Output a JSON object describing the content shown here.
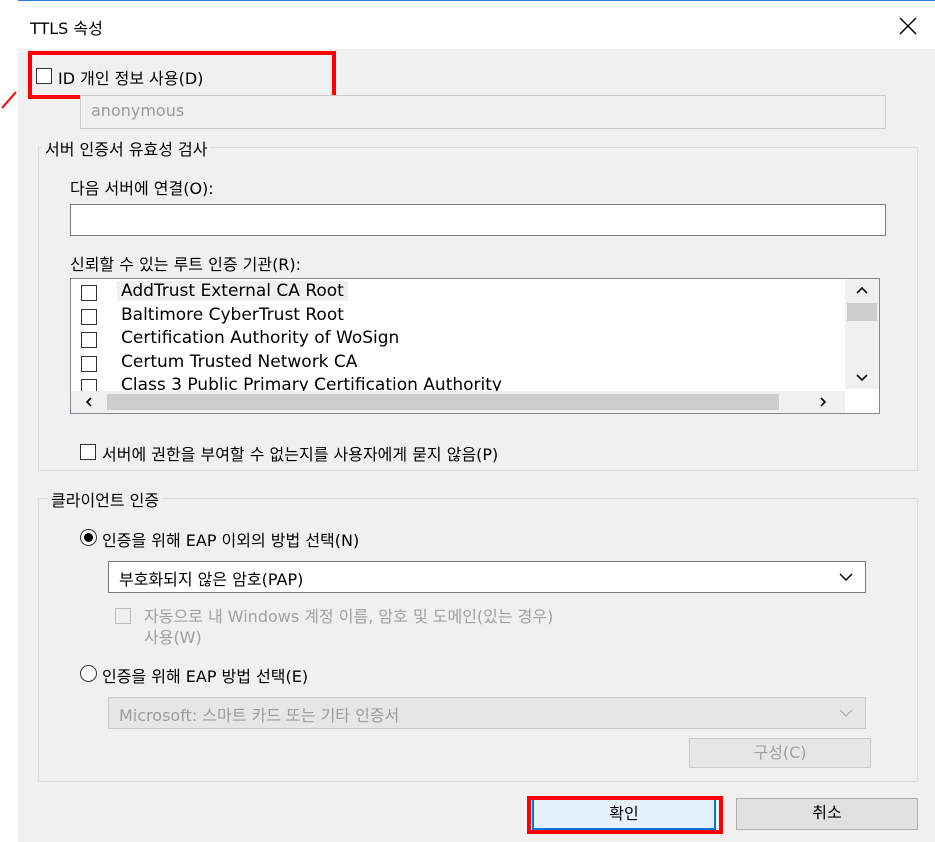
{
  "dialog": {
    "title": "TTLS 속성",
    "close_icon": "close-icon"
  },
  "identity": {
    "checkbox_label": "ID 개인 정보 사용(D)",
    "checked": false,
    "value": "anonymous"
  },
  "server_validation": {
    "group_label": "서버 인증서 유효성 검사",
    "connect_label": "다음 서버에 연결(O):",
    "connect_value": "",
    "trusted_ca_label": "신뢰할 수 있는 루트 인증 기관(R):",
    "ca_list": [
      {
        "name": "AddTrust External CA Root",
        "checked": false
      },
      {
        "name": "Baltimore CyberTrust Root",
        "checked": false
      },
      {
        "name": "Certification Authority of WoSign",
        "checked": false
      },
      {
        "name": "Certum Trusted Network CA",
        "checked": false
      },
      {
        "name": "Class 3 Public Primary Certification Authority",
        "checked": false
      }
    ],
    "no_prompt_label": "서버에 권한을 부여할 수 없는지를 사용자에게 묻지 않음(P)"
  },
  "client_auth": {
    "group_label": "클라이언트 인증",
    "non_eap_label": "인증을 위해 EAP 이외의 방법 선택(N)",
    "non_eap_selected": true,
    "non_eap_method": "부호화되지 않은 암호(PAP)",
    "auto_windows_label_line1": "자동으로 내 Windows 계정 이름, 암호 및 도메인(있는 경우)",
    "auto_windows_label_line2": "사용(W)",
    "eap_label": "인증을 위해 EAP 방법 선택(E)",
    "eap_selected": false,
    "eap_method": "Microsoft: 스마트 카드 또는 기타 인증서",
    "configure_label": "구성(C)"
  },
  "footer": {
    "ok_label": "확인",
    "cancel_label": "취소"
  },
  "colors": {
    "annotation": "#ff0000",
    "accent": "#0078d7",
    "titlebar_border": "#2b79d8"
  }
}
